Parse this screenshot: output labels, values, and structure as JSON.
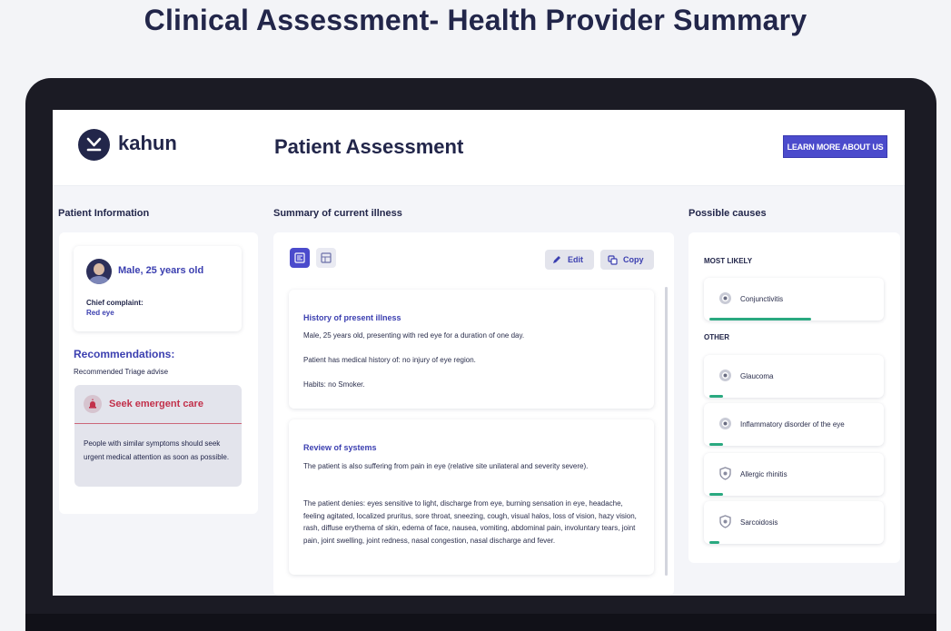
{
  "page": {
    "title": "Clinical Assessment- Health Provider Summary"
  },
  "header": {
    "logo_text": "kahun",
    "title": "Patient Assessment",
    "cta_label": "LEARN MORE ABOUT US"
  },
  "columns": {
    "patient_info": "Patient Information",
    "summary": "Summary of current illness",
    "causes": "Possible causes"
  },
  "patient": {
    "name": "Male, 25 years old",
    "complaint_label": "Chief complaint:",
    "complaint_value": "Red eye"
  },
  "recommendations": {
    "title": "Recommendations:",
    "subtitle": "Recommended Triage advise",
    "triage_heading": "Seek emergent care",
    "triage_text": "People with similar symptoms should seek urgent medical attention as soon as possible."
  },
  "toolbar": {
    "edit_label": "Edit",
    "copy_label": "Copy"
  },
  "summary": {
    "hpi": {
      "title": "History of present illness",
      "line1": "Male, 25 years old, presenting with red eye for a duration of one day.",
      "line2": "Patient has medical history of: no injury of eye region.",
      "line3": "Habits: no Smoker."
    },
    "ros": {
      "title": "Review of systems",
      "para1": "The patient is also suffering from pain in eye (relative site unilateral and severity severe).",
      "para2": "The patient denies: eyes sensitive to light, discharge from eye, burning sensation in eye, headache, feeling agitated, localized pruritus, sore throat, sneezing, cough, visual halos, loss of vision, hazy vision, rash, diffuse erythema of skin, edema of face, nausea, vomiting, abdominal pain, involuntary tears, joint pain, joint swelling, joint redness, nasal congestion, nasal discharge and fever."
    }
  },
  "causes": {
    "most_likely_label": "MOST LIKELY",
    "other_label": "OTHER",
    "most_likely": [
      {
        "name": "Conjunctivitis",
        "icon": "eye-icon",
        "likelihood": 0.6
      }
    ],
    "other": [
      {
        "name": "Glaucoma",
        "icon": "eye-icon",
        "likelihood": 0.08
      },
      {
        "name": "Inflammatory disorder of the eye",
        "icon": "eye-icon",
        "likelihood": 0.08
      },
      {
        "name": "Allergic rhinitis",
        "icon": "shield-icon",
        "likelihood": 0.08
      },
      {
        "name": "Sarcoidosis",
        "icon": "shield-icon",
        "likelihood": 0.06
      }
    ]
  },
  "colors": {
    "accent": "#4b4bcc",
    "danger": "#c2304a",
    "likelihood_bar": "#2aa980",
    "navy": "#22264a"
  }
}
